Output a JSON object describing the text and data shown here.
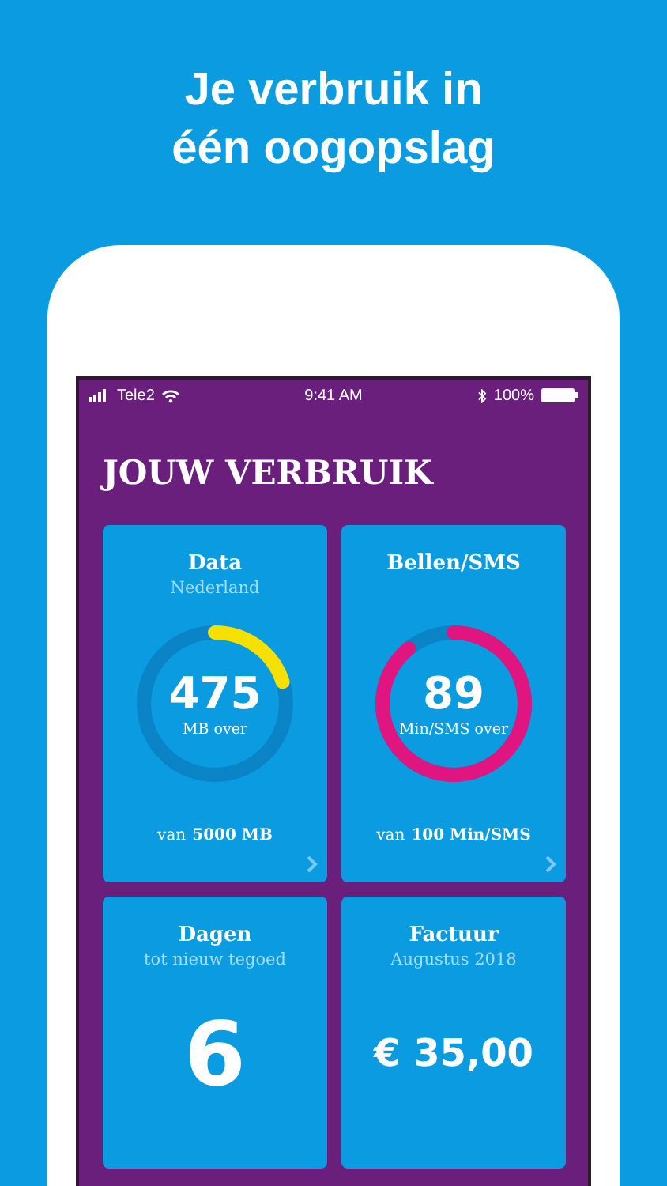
{
  "headline": [
    "Je verbruik in",
    "één oogopslag"
  ],
  "status_bar": {
    "carrier": "Tele2",
    "time": "9:41 AM",
    "battery": "100%"
  },
  "title": "JOUW VERBRUIK",
  "cards": [
    {
      "kind": "ring",
      "title": "Data",
      "subtitle": "Nederland",
      "value": "475",
      "unit": "MB over",
      "footer_prefix": "van",
      "footer_amount": "5000 MB",
      "level": 0.2,
      "color": "#f5e000"
    },
    {
      "kind": "ring",
      "title": "Bellen/SMS",
      "value": "89",
      "unit": "Min/SMS over",
      "footer_prefix": "van",
      "footer_amount": "100 Min/SMS",
      "level": 0.89,
      "color": "#e0157f"
    },
    {
      "kind": "value",
      "title": "Dagen",
      "subtitle": "tot nieuw tegoed",
      "value": "6"
    },
    {
      "kind": "amount",
      "title": "Factuur",
      "subtitle": "Augustus 2018",
      "value": "€ 35,00"
    }
  ]
}
